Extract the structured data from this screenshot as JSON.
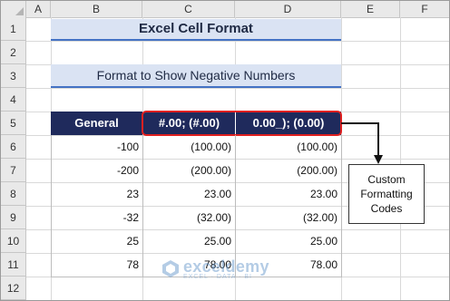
{
  "columns": [
    "A",
    "B",
    "C",
    "D",
    "E",
    "F"
  ],
  "rows": [
    "1",
    "2",
    "3",
    "4",
    "5",
    "6",
    "7",
    "8",
    "9",
    "10",
    "11",
    "12"
  ],
  "title": "Excel Cell Format",
  "subtitle": "Format to Show Negative Numbers",
  "table": {
    "headers": [
      "General",
      "#.00; (#.00)",
      "0.00_); (0.00)"
    ],
    "rows": [
      [
        "-100",
        "(100.00)",
        "(100.00)"
      ],
      [
        "-200",
        "(200.00)",
        "(200.00)"
      ],
      [
        "23",
        "23.00",
        "23.00"
      ],
      [
        "-32",
        "(32.00)",
        "(32.00)"
      ],
      [
        "25",
        "25.00",
        "25.00"
      ],
      [
        "78",
        "78.00",
        "78.00"
      ]
    ]
  },
  "callout": {
    "text": "Custom Formatting Codes"
  },
  "watermark": {
    "name": "exceldemy",
    "tagline": "EXCEL · DATA · BI"
  },
  "colors": {
    "header_fill": "#1f2a5c",
    "title_fill": "#dae3f3",
    "highlight_border": "#e02020"
  }
}
